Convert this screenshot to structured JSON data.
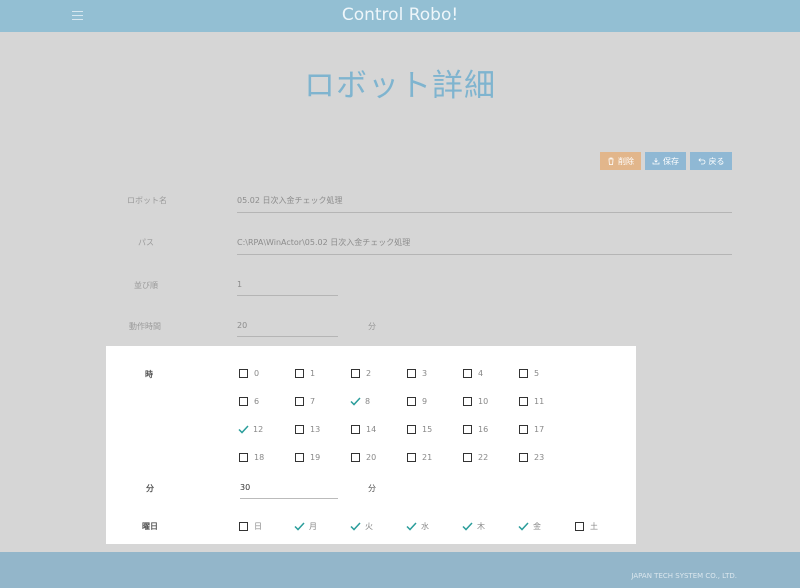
{
  "header": {
    "app_title": "Control Robo!"
  },
  "page": {
    "title": "ロボット詳細"
  },
  "toolbar": {
    "delete_label": "削除",
    "save_label": "保存",
    "back_label": "戻る"
  },
  "form": {
    "robot_name_label": "ロボット名",
    "robot_name_value": "05.02 日次入金チェック処理",
    "path_label": "パス",
    "path_value": "C:\\RPA\\WinActor\\05.02 日次入金チェック処理",
    "order_label": "並び順",
    "order_value": "1",
    "duration_label": "動作時間",
    "duration_value": "20",
    "duration_unit": "分"
  },
  "schedule": {
    "hour_label": "時",
    "hours": [
      {
        "label": "0",
        "checked": false
      },
      {
        "label": "1",
        "checked": false
      },
      {
        "label": "2",
        "checked": false
      },
      {
        "label": "3",
        "checked": false
      },
      {
        "label": "4",
        "checked": false
      },
      {
        "label": "5",
        "checked": false
      },
      {
        "label": "6",
        "checked": false
      },
      {
        "label": "7",
        "checked": false
      },
      {
        "label": "8",
        "checked": true
      },
      {
        "label": "9",
        "checked": false
      },
      {
        "label": "10",
        "checked": false
      },
      {
        "label": "11",
        "checked": false
      },
      {
        "label": "12",
        "checked": true
      },
      {
        "label": "13",
        "checked": false
      },
      {
        "label": "14",
        "checked": false
      },
      {
        "label": "15",
        "checked": false
      },
      {
        "label": "16",
        "checked": false
      },
      {
        "label": "17",
        "checked": false
      },
      {
        "label": "18",
        "checked": false
      },
      {
        "label": "19",
        "checked": false
      },
      {
        "label": "20",
        "checked": false
      },
      {
        "label": "21",
        "checked": false
      },
      {
        "label": "22",
        "checked": false
      },
      {
        "label": "23",
        "checked": false
      }
    ],
    "minute_label": "分",
    "minute_value": "30",
    "minute_unit": "分",
    "weekday_label": "曜日",
    "weekdays": [
      {
        "label": "日",
        "checked": false
      },
      {
        "label": "月",
        "checked": true
      },
      {
        "label": "火",
        "checked": true
      },
      {
        "label": "水",
        "checked": true
      },
      {
        "label": "木",
        "checked": true
      },
      {
        "label": "金",
        "checked": true
      },
      {
        "label": "土",
        "checked": false
      }
    ]
  },
  "footer": {
    "copyright": "JAPAN TECH SYSTEM CO., LTD."
  },
  "colors": {
    "accent": "#7fb4cf",
    "header": "#93bfd3",
    "check": "#2a9d9b",
    "delete": "#e2b68b"
  }
}
